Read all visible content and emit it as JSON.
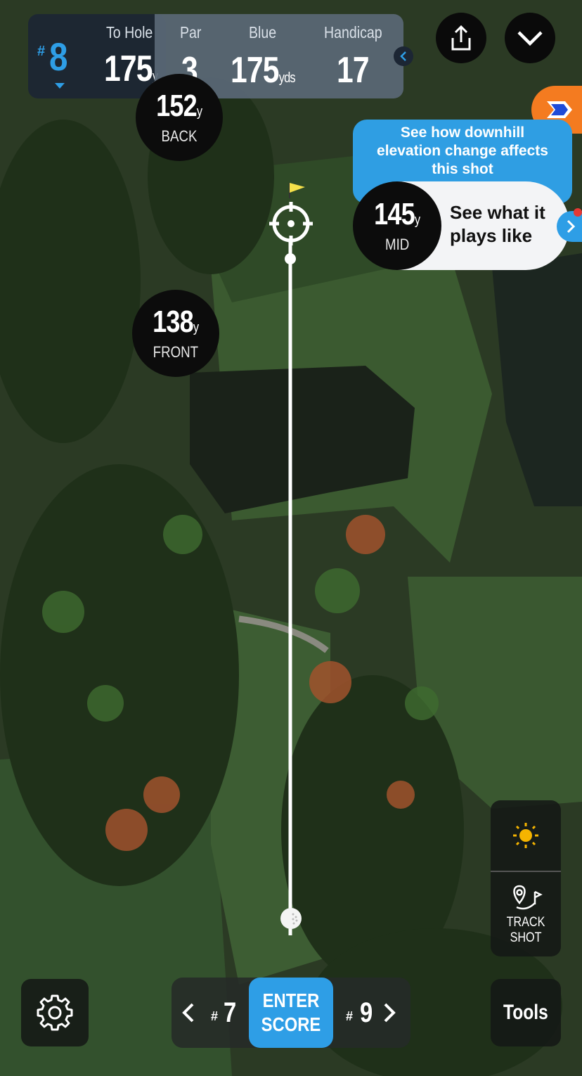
{
  "header": {
    "hole_prefix": "#",
    "hole_number": "8",
    "to_hole_label": "To Hole",
    "to_hole_value": "175",
    "to_hole_unit": "y",
    "par_label": "Par",
    "par_value": "3",
    "tee_label": "Blue",
    "tee_value": "175",
    "tee_unit": "yds",
    "handicap_label": "Handicap",
    "handicap_value": "17"
  },
  "markers": {
    "back": {
      "value": "152",
      "unit": "y",
      "label": "BACK"
    },
    "front": {
      "value": "138",
      "unit": "y",
      "label": "FRONT"
    },
    "mid": {
      "value": "145",
      "unit": "y",
      "label": "MID"
    }
  },
  "elevation_tip": {
    "line1": "See how downhill",
    "line2": "elevation change affects",
    "line3": "this shot"
  },
  "plays_like": {
    "line1": "See what it",
    "line2": "plays like"
  },
  "tools": {
    "track_line1": "TRACK",
    "track_line2": "SHOT",
    "tools_label": "Tools"
  },
  "nav": {
    "prev_prefix": "#",
    "prev_hole": "7",
    "enter_line1": "ENTER",
    "enter_line2": "SCORE",
    "next_prefix": "#",
    "next_hole": "9"
  },
  "colors": {
    "accent": "#2e9ee6",
    "dark": "#0c0c0c",
    "header_dark": "#1c2634",
    "header_mid": "#5a6876",
    "badge_orange": "#f47b20"
  },
  "icons": [
    "share-icon",
    "chevron-down-icon",
    "chevron-left-icon",
    "sun-icon",
    "track-shot-icon",
    "settings-gear-icon",
    "chevron-right-icon",
    "flag-icon",
    "target-icon",
    "golf-ball-icon"
  ]
}
